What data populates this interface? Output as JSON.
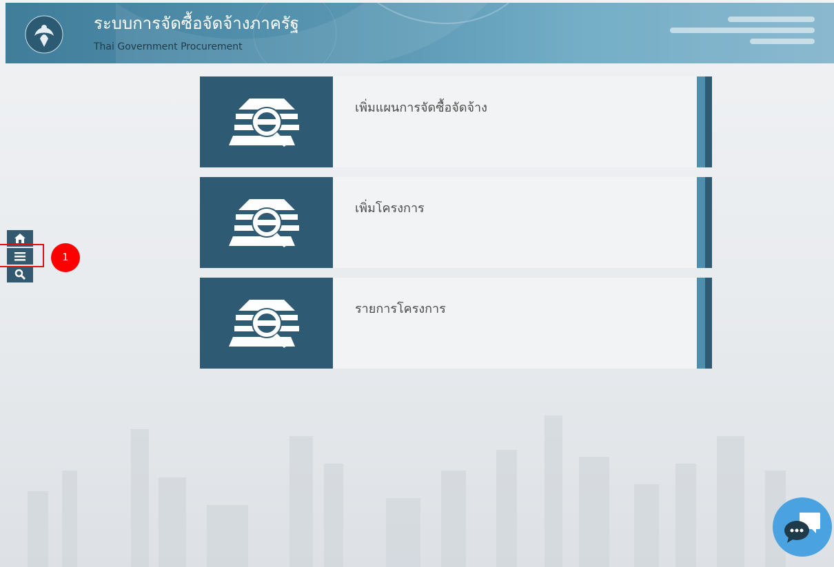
{
  "header": {
    "title_th": "ระบบการจัดซื้อจัดจ้างภาครัฐ",
    "title_en": "Thai Government Procurement",
    "logo_icon": "government-emblem-icon"
  },
  "side_nav": {
    "items": [
      {
        "icon": "home-icon"
      },
      {
        "icon": "menu-icon"
      },
      {
        "icon": "search-icon"
      }
    ]
  },
  "annotation": {
    "marker_label": "1"
  },
  "menu": {
    "items": [
      {
        "label": "เพิ่มแผนการจัดซื้อจัดจ้าง",
        "icon": "procurement-search-icon"
      },
      {
        "label": "เพิ่มโครงการ",
        "icon": "procurement-search-icon"
      },
      {
        "label": "รายการโครงการ",
        "icon": "procurement-search-icon"
      }
    ]
  },
  "chat": {
    "icon": "chat-icon"
  },
  "colors": {
    "primary": "#2f5a74",
    "accent": "#4e8fad",
    "chat": "#4aa3e0",
    "marker": "#ff0000"
  }
}
